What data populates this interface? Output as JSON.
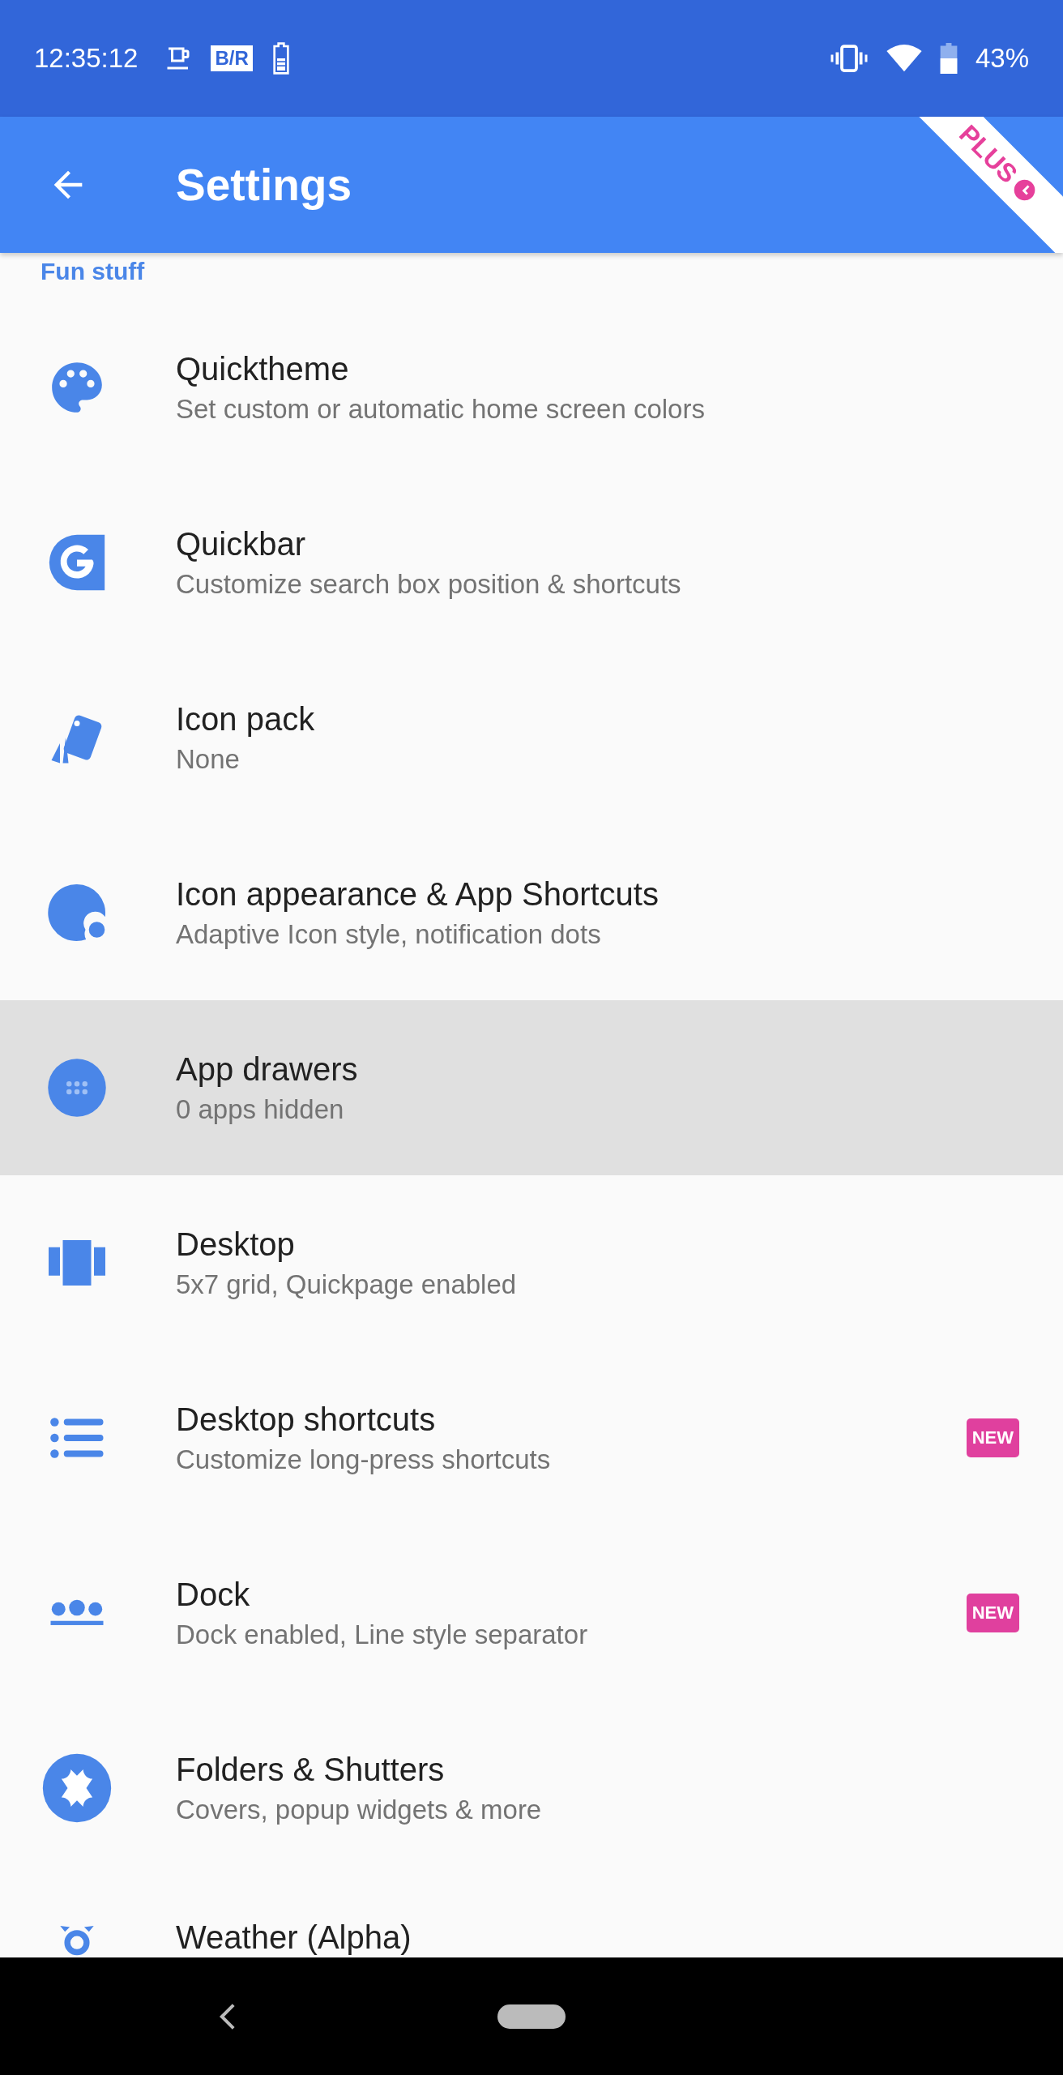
{
  "status_bar": {
    "time": "12:35:12",
    "badge": "B/R",
    "battery": "43%"
  },
  "app_bar": {
    "title": "Settings",
    "ribbon": "PLUS"
  },
  "section": "Fun stuff",
  "items": [
    {
      "title": "Quicktheme",
      "subtitle": "Set custom or automatic home screen colors",
      "selected": false
    },
    {
      "title": "Quickbar",
      "subtitle": "Customize search box position & shortcuts",
      "selected": false
    },
    {
      "title": "Icon pack",
      "subtitle": "None",
      "selected": false
    },
    {
      "title": "Icon appearance & App Shortcuts",
      "subtitle": "Adaptive Icon style, notification dots",
      "selected": false
    },
    {
      "title": "App drawers",
      "subtitle": "0 apps hidden",
      "selected": true
    },
    {
      "title": "Desktop",
      "subtitle": "5x7 grid, Quickpage enabled",
      "selected": false
    },
    {
      "title": "Desktop shortcuts",
      "subtitle": "Customize long-press shortcuts",
      "badge": "NEW",
      "selected": false
    },
    {
      "title": "Dock",
      "subtitle": "Dock enabled, Line style separator",
      "badge": "NEW",
      "selected": false
    },
    {
      "title": "Folders & Shutters",
      "subtitle": "Covers, popup widgets & more",
      "selected": false
    },
    {
      "title": "Weather (Alpha)",
      "selected": false
    }
  ]
}
